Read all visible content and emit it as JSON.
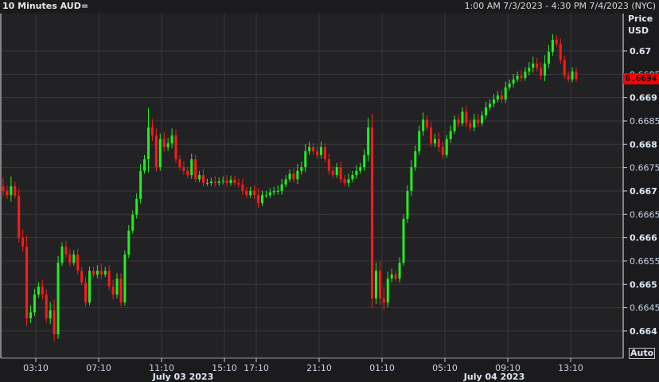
{
  "header": {
    "title": "10 Minutes AUD=",
    "range": "1:00 AM 7/3/2023 - 4:30 PM 7/4/2023 (NYC)"
  },
  "axis": {
    "price_label": "Price",
    "currency_label": "USD",
    "last_price": "0.6694",
    "auto_label": "Auto"
  },
  "colors": {
    "up": "#22ee22",
    "down": "#ff1a1a",
    "last_price_bg": "#ff0000"
  },
  "chart_data": {
    "type": "candlestick",
    "title": "10 Minutes AUD=",
    "ylabel": "Price USD",
    "ylim": [
      0.66365,
      0.6728
    ],
    "y_ticks": [
      "0.67",
      "0.6695",
      "0.669",
      "0.6685",
      "0.668",
      "0.6675",
      "0.667",
      "0.6665",
      "0.666",
      "0.6655",
      "0.665",
      "0.6645",
      "0.664"
    ],
    "y_tick_values": [
      0.67,
      0.6695,
      0.669,
      0.6685,
      0.668,
      0.6675,
      0.667,
      0.6665,
      0.666,
      0.6655,
      0.665,
      0.6645,
      0.664
    ],
    "x_ticks": [
      "03:10",
      "07:10",
      "11:10",
      "15:10",
      "17:10",
      "21:10",
      "01:10",
      "05:10",
      "09:10",
      "13:10"
    ],
    "date_labels": [
      "July 03 2023",
      "July 04 2023"
    ],
    "first_open": 0.6671,
    "close": [
      0.667,
      0.66691,
      0.6671,
      0.6669,
      0.666,
      0.66581,
      0.66427,
      0.6644,
      0.66478,
      0.66495,
      0.66478,
      0.66427,
      0.66444,
      0.66393,
      0.66546,
      0.66581,
      0.66564,
      0.66546,
      0.66564,
      0.66529,
      0.66504,
      0.66461,
      0.66529,
      0.66521,
      0.66529,
      0.66521,
      0.66529,
      0.66495,
      0.66478,
      0.66512,
      0.66461,
      0.66564,
      0.66615,
      0.66649,
      0.66683,
      0.66743,
      0.66768,
      0.66836,
      0.66819,
      0.66751,
      0.66811,
      0.66794,
      0.66802,
      0.66819,
      0.66768,
      0.66751,
      0.66743,
      0.66734,
      0.66768,
      0.66725,
      0.66734,
      0.66717,
      0.66717,
      0.6672,
      0.66717,
      0.6672,
      0.66722,
      0.66717,
      0.66724,
      0.66717,
      0.66714,
      0.667,
      0.66691,
      0.667,
      0.66691,
      0.66674,
      0.66691,
      0.66691,
      0.66697,
      0.667,
      0.667,
      0.66714,
      0.66725,
      0.66737,
      0.66725,
      0.66743,
      0.66751,
      0.66785,
      0.66794,
      0.66785,
      0.66777,
      0.66794,
      0.66768,
      0.66743,
      0.66734,
      0.66751,
      0.66725,
      0.66717,
      0.66725,
      0.66734,
      0.66743,
      0.66751,
      0.66777,
      0.66836,
      0.6647,
      0.66529,
      0.6647,
      0.66461,
      0.66512,
      0.66521,
      0.66512,
      0.66546,
      0.6664,
      0.667,
      0.66751,
      0.66785,
      0.66828,
      0.66853,
      0.66836,
      0.66802,
      0.66811,
      0.66794,
      0.66777,
      0.66811,
      0.66828,
      0.66853,
      0.66845,
      0.6687,
      0.66845,
      0.66836,
      0.66853,
      0.66845,
      0.66862,
      0.66879,
      0.66887,
      0.66896,
      0.66905,
      0.66896,
      0.66922,
      0.6693,
      0.66939,
      0.66947,
      0.66942,
      0.66956,
      0.66964,
      0.66973,
      0.66964,
      0.66947,
      0.66973,
      0.66998,
      0.67024,
      0.67015,
      0.66981,
      0.66947,
      0.66939,
      0.66956,
      0.6694
    ],
    "wick_1e5": [
      30,
      20,
      35,
      15,
      25,
      30,
      40,
      25,
      20,
      15,
      25,
      20,
      30,
      40,
      25,
      15,
      20,
      20,
      15,
      20,
      15,
      20,
      15,
      15,
      20,
      25,
      15,
      20,
      25,
      20,
      20,
      15,
      20,
      15,
      20,
      25,
      15,
      70,
      30,
      25,
      20,
      25,
      20,
      25,
      20,
      15,
      20,
      15,
      20,
      15,
      15,
      20,
      15,
      15,
      20,
      15,
      15,
      20,
      15,
      15,
      15,
      20,
      15,
      15,
      20,
      25,
      15,
      15,
      15,
      15,
      20,
      20,
      15,
      15,
      20,
      25,
      20,
      25,
      20,
      15,
      20,
      20,
      15,
      20,
      15,
      15,
      20,
      15,
      20,
      15,
      20,
      15,
      20,
      34,
      50,
      30,
      35,
      40,
      25,
      20,
      15,
      20,
      15,
      20,
      25,
      20,
      20,
      25,
      15,
      20,
      20,
      25,
      20,
      15,
      20,
      15,
      20,
      15,
      20,
      15,
      20,
      20,
      15,
      20,
      15,
      20,
      15,
      20,
      20,
      15,
      20,
      15,
      20,
      15,
      20,
      25,
      20,
      20,
      30,
      25,
      20,
      15,
      20,
      15,
      15
    ]
  }
}
